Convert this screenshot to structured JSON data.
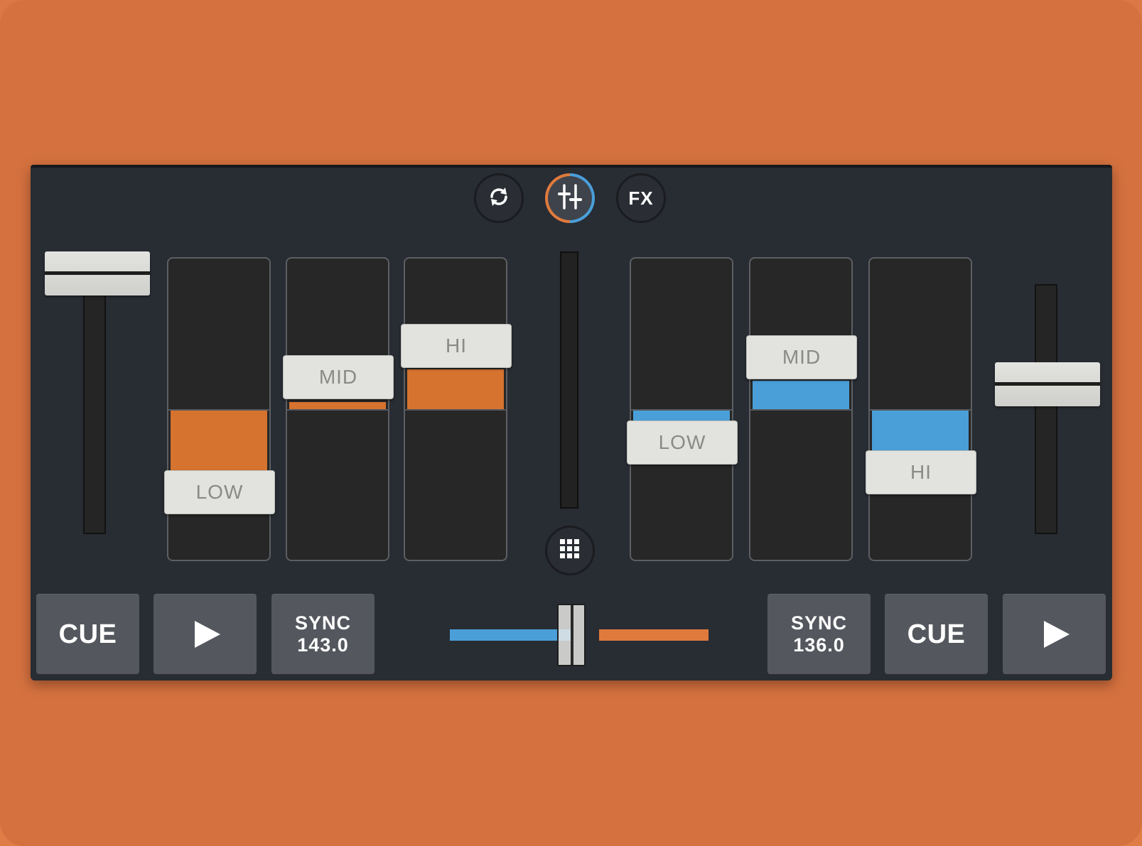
{
  "colors": {
    "background": "#d5713f",
    "panel": "#282c33",
    "deck_a_accent": "#e07a3c",
    "deck_b_accent": "#4a9fd9",
    "button": "#54575e",
    "knob": "#e2e2de"
  },
  "top_controls": {
    "loop_icon": "refresh-icon",
    "mixer_icon": "sliders-icon",
    "fx_label": "FX",
    "grid_icon": "grid-icon"
  },
  "deck_a": {
    "eq": {
      "low_label": "LOW",
      "mid_label": "MID",
      "hi_label": "HI",
      "low_level": -0.45,
      "mid_level": 0.02,
      "hi_level": 0.3
    },
    "volume_level": 1.0,
    "cue_label": "CUE",
    "play_icon": "play-icon",
    "sync_label": "SYNC",
    "bpm": "143.0"
  },
  "deck_b": {
    "eq": {
      "low_label": "LOW",
      "mid_label": "MID",
      "hi_label": "HI",
      "low_level": -0.06,
      "mid_level": 0.2,
      "hi_level": -0.3
    },
    "volume_level": 0.6,
    "cue_label": "CUE",
    "play_icon": "play-icon",
    "sync_label": "SYNC",
    "bpm": "136.0"
  },
  "crossfader_position": 0.5
}
